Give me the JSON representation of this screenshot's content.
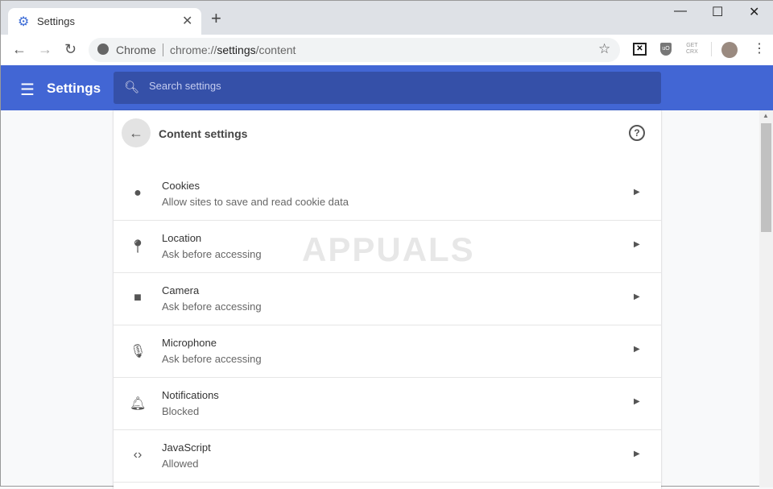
{
  "tab": {
    "title": "Settings",
    "icon": "gear-icon"
  },
  "window": {
    "minimize": "—",
    "maximize": "☐",
    "close": "✕"
  },
  "omnibox": {
    "site": "Chrome",
    "url_prefix": "chrome://",
    "url_host": "settings",
    "url_path": "/content"
  },
  "extensions": {
    "crx_line1": "GET",
    "crx_line2": "CRX"
  },
  "header": {
    "title": "Settings",
    "search_placeholder": "Search settings",
    "color": "#4266d4"
  },
  "content": {
    "title": "Content settings",
    "help": "?",
    "rows": [
      {
        "title": "Cookies",
        "subtitle": "Allow sites to save and read cookie data",
        "icon": "cookie-icon"
      },
      {
        "title": "Location",
        "subtitle": "Ask before accessing",
        "icon": "location-pin-icon"
      },
      {
        "title": "Camera",
        "subtitle": "Ask before accessing",
        "icon": "camera-icon"
      },
      {
        "title": "Microphone",
        "subtitle": "Ask before accessing",
        "icon": "microphone-icon"
      },
      {
        "title": "Notifications",
        "subtitle": "Blocked",
        "icon": "bell-icon"
      },
      {
        "title": "JavaScript",
        "subtitle": "Allowed",
        "icon": "code-icon"
      }
    ]
  },
  "watermark": "APPUALS"
}
